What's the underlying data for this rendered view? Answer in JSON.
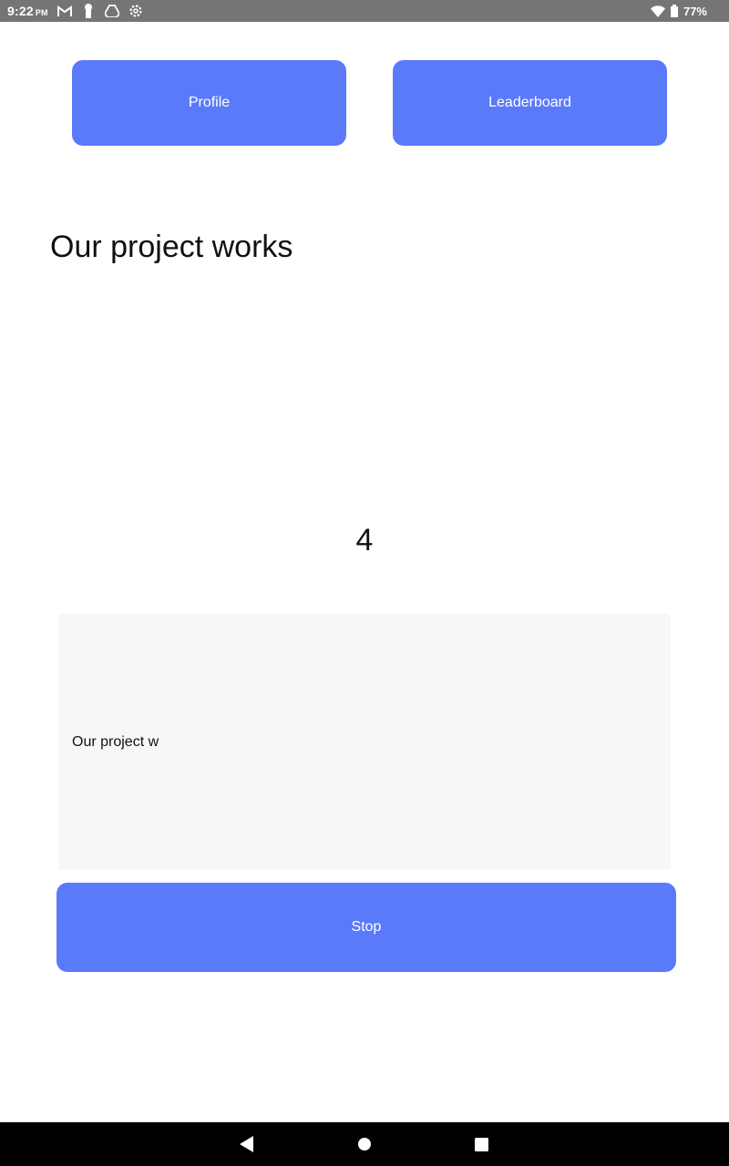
{
  "status_bar": {
    "time": "9:22",
    "ampm": "PM",
    "battery_percent": "77%",
    "icons": [
      "gmail-icon",
      "keyhole-icon",
      "drive-icon",
      "settings-icon",
      "wifi-icon",
      "battery-icon"
    ]
  },
  "top_buttons": {
    "profile_label": "Profile",
    "leaderboard_label": "Leaderboard"
  },
  "main": {
    "prompt_text": "Our project works",
    "counter": "4",
    "input_value": "Our project w",
    "stop_label": "Stop"
  },
  "nav_bar": {
    "icons": [
      "back-icon",
      "home-icon",
      "recents-icon"
    ]
  },
  "colors": {
    "accent": "#5b7afa",
    "status_bar": "#757575",
    "input_background": "#f6f7f9",
    "nav_bar": "#000000"
  }
}
